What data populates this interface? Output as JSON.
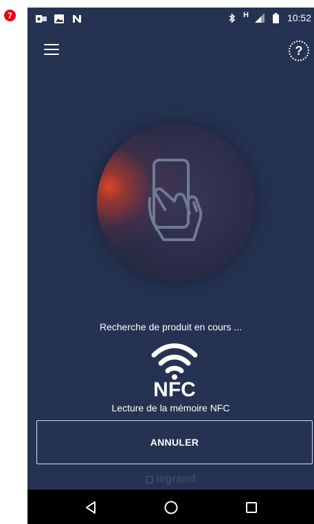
{
  "step_badge": "7",
  "status_bar": {
    "time": "10:52",
    "network_type": "H",
    "left_icons": [
      "outlook-icon",
      "image-icon",
      "n-app-icon"
    ],
    "right_icons": [
      "bluetooth-icon",
      "signal-icon",
      "battery-icon"
    ]
  },
  "top_bar": {
    "menu_icon": "hamburger-menu-icon",
    "help_label": "?"
  },
  "scan": {
    "status_text": "Recherche de produit en cours ...",
    "nfc_label": "NFC",
    "reading_text": "Lecture de la mémoire NFC"
  },
  "actions": {
    "cancel_label": "ANNULER"
  },
  "brand": {
    "name": "legrand"
  },
  "navigation": {
    "buttons": [
      "back-icon",
      "home-icon",
      "recents-icon"
    ]
  },
  "colors": {
    "background": "#263252",
    "accent_glow": "#e84623",
    "badge": "#e30613"
  }
}
